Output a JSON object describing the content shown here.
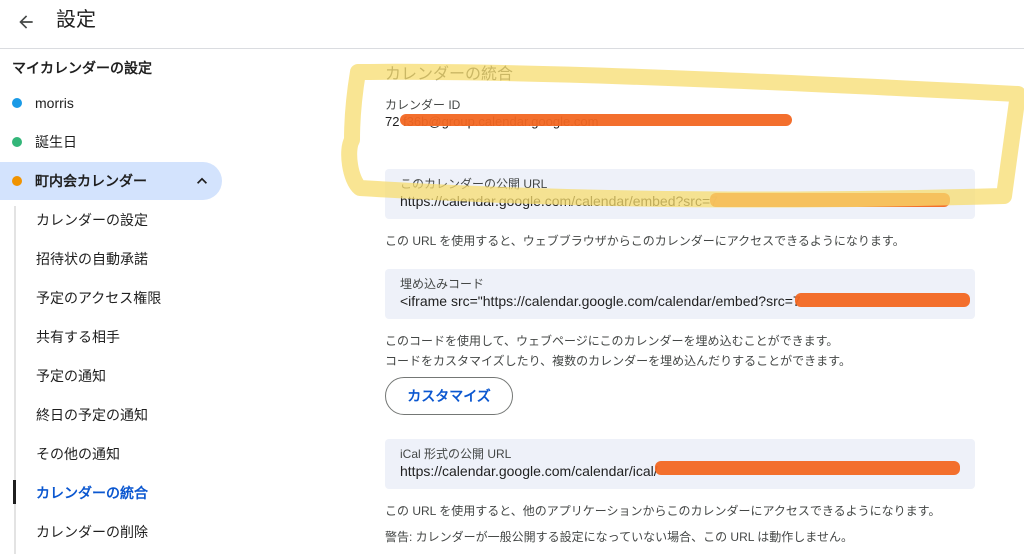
{
  "header": {
    "title": "設定"
  },
  "sidebar": {
    "heading": "マイカレンダーの設定",
    "calendars": [
      {
        "label": "morris",
        "color": "#1a9ae6"
      },
      {
        "label": "誕生日",
        "color": "#33b679"
      },
      {
        "label": "町内会カレンダー",
        "color": "#f09300"
      }
    ],
    "sub_items": [
      "カレンダーの設定",
      "招待状の自動承諾",
      "予定のアクセス権限",
      "共有する相手",
      "予定の通知",
      "終日の予定の通知",
      "その他の通知",
      "カレンダーの統合",
      "カレンダーの削除"
    ]
  },
  "main": {
    "section_title": "カレンダーの統合",
    "calendar_id": {
      "label": "カレンダー ID",
      "value_visible": "72 f36b@group.calendar.google.com"
    },
    "public_url": {
      "label": "このカレンダーの公開 URL",
      "value": "https://calendar.google.com/calendar/embed?src=7",
      "note": "この URL を使用すると、ウェブブラウザからこのカレンダーにアクセスできるようになります。"
    },
    "embed_code": {
      "label": "埋め込みコード",
      "value": "<iframe src=\"https://calendar.google.com/calendar/embed?src=7",
      "note1": "このコードを使用して、ウェブページにこのカレンダーを埋め込むことができます。",
      "note2": "コードをカスタマイズしたり、複数のカレンダーを埋め込んだりすることができます。"
    },
    "customize_button": "カスタマイズ",
    "ical_url": {
      "label": "iCal 形式の公開 URL",
      "value": "https://calendar.google.com/calendar/ical/",
      "note": "この URL を使用すると、他のアプリケーションからこのカレンダーにアクセスできるようになります。",
      "warning": "警告: カレンダーが一般公開する設定になっていない場合、この URL は動作しません。"
    }
  },
  "colors": {
    "accent": "#0b57d0",
    "active_bg": "#d3e3fd",
    "field_bg": "#eef1f9",
    "redaction": "#f26722",
    "highlight": "#f7dc6f"
  }
}
